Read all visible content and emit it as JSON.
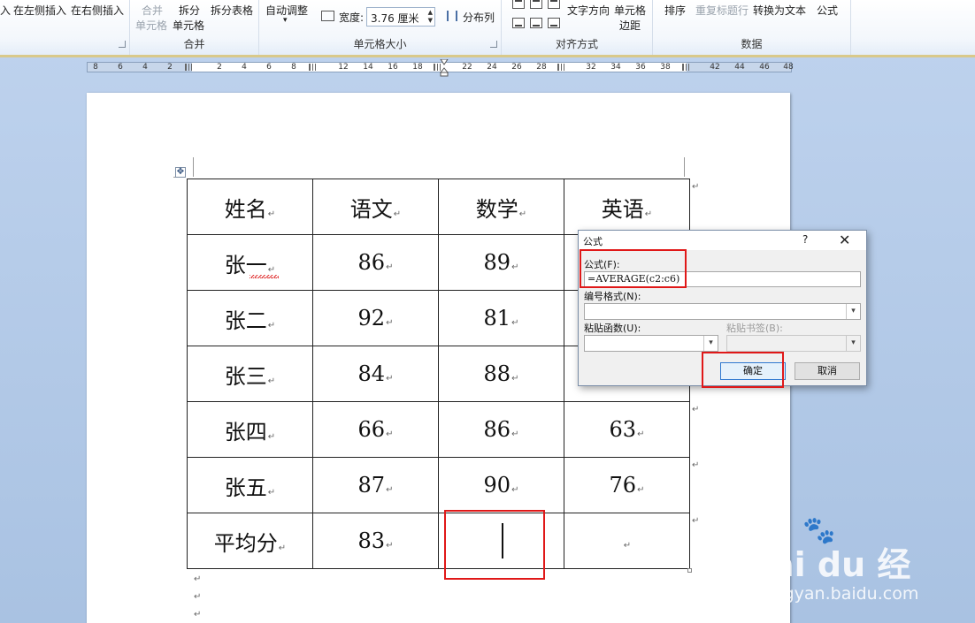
{
  "ribbon": {
    "insert": {
      "partial": "入",
      "left": "在左侧插入",
      "right": "在右侧插入"
    },
    "merge": {
      "label": "合并",
      "merge_cells_1": "合并",
      "merge_cells_2": "单元格",
      "split_cells_1": "拆分",
      "split_cells_2": "单元格",
      "split_table": "拆分表格"
    },
    "cell_size": {
      "label": "单元格大小",
      "auto_fit": "自动调整",
      "width_label": "宽度:",
      "width_value": "3.76 厘米",
      "distribute_cols": "分布列"
    },
    "alignment": {
      "label": "对齐方式",
      "text_direction": "文字方向",
      "cell_margins_1": "单元格",
      "cell_margins_2": "边距"
    },
    "data": {
      "label": "数据",
      "sort": "排序",
      "repeat_header": "重复标题行",
      "convert_to_text": "转换为文本",
      "formula": "公式"
    }
  },
  "ruler": {
    "left": [
      "8",
      "6",
      "4",
      "2"
    ],
    "middle": [
      "2",
      "4",
      "6",
      "8",
      "12",
      "14",
      "16",
      "18",
      "22",
      "24",
      "26",
      "28",
      "32"
    ],
    "right": [
      "34",
      "36",
      "38",
      "42",
      "44",
      "46",
      "48"
    ]
  },
  "table": {
    "headers": [
      "姓名",
      "语文",
      "数学",
      "英语"
    ],
    "rows": [
      [
        "张一",
        "86",
        "89",
        ""
      ],
      [
        "张二",
        "92",
        "81",
        ""
      ],
      [
        "张三",
        "84",
        "88",
        ""
      ],
      [
        "张四",
        "66",
        "86",
        "63"
      ],
      [
        "张五",
        "87",
        "90",
        "76"
      ],
      [
        "平均分",
        "83",
        "",
        ""
      ]
    ],
    "paragraph_mark": "↵"
  },
  "dialog": {
    "title": "公式",
    "help": "?",
    "close": "✕",
    "formula_label": "公式(F):",
    "formula_value": "=AVERAGE(c2:c6)",
    "number_format_label": "编号格式(N):",
    "paste_function_label": "粘贴函数(U):",
    "paste_bookmark_label": "粘贴书签(B):",
    "ok": "确定",
    "cancel": "取消"
  },
  "watermark": {
    "logo": "Bai du 经验",
    "url": "jingyan.baidu.com"
  },
  "colors": {
    "highlight_red": "#e01818",
    "dialog_default_border": "#2f78d0",
    "background_blue": "#abc3e3"
  },
  "icons": [
    "table-move-icon",
    "width-icon",
    "distribute-columns-icon",
    "align-icons",
    "help-icon",
    "close-icon",
    "dropdown-arrow-icon"
  ]
}
